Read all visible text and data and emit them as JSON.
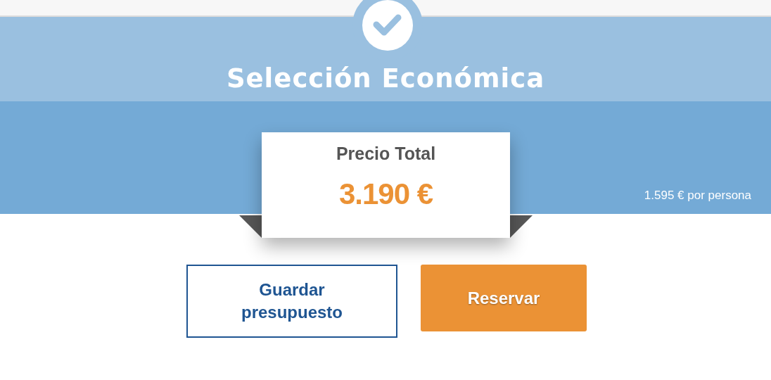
{
  "title": "Selección Económica",
  "price_card": {
    "label": "Precio Total",
    "amount": "3.190 €"
  },
  "per_person": "1.595 € por persona",
  "buttons": [
    {
      "label": "Guardar presupuesto",
      "kind": "outline"
    },
    {
      "label": "Reservar",
      "kind": "primary"
    }
  ]
}
